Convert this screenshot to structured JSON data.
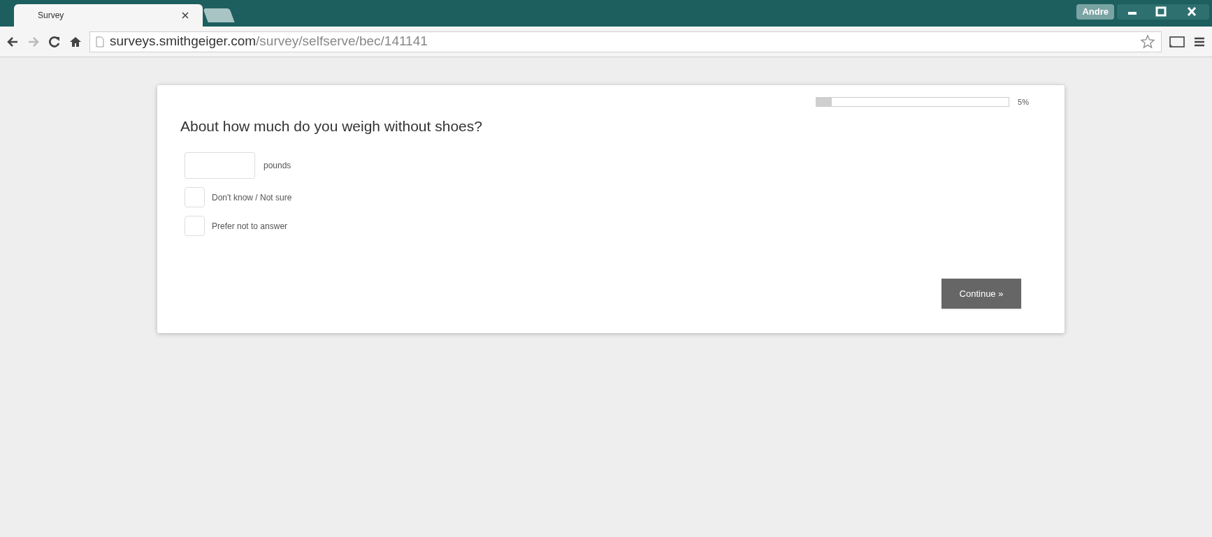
{
  "browser": {
    "tabs": [
      {
        "title": "Survey",
        "selected": true
      }
    ],
    "profile": "Andre",
    "url_host": "surveys.smithgeiger.com",
    "url_path": "/survey/selfserve/bec/141141"
  },
  "survey": {
    "progress": {
      "level": 0.08,
      "label": "5%"
    },
    "question": "About how much do you weigh without shoes?",
    "answer_field": {
      "unit": "pounds"
    },
    "options": [
      {
        "label": "Don't know / Not sure",
        "checked": false
      },
      {
        "label": "Prefer not to answer",
        "checked": false
      }
    ],
    "continue_button": "Continue »"
  }
}
